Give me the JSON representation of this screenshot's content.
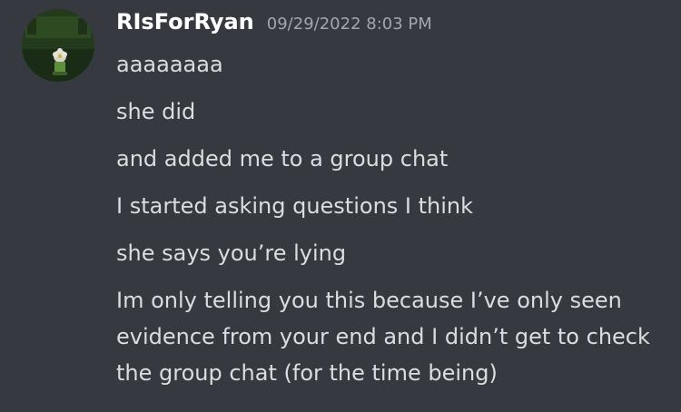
{
  "message": {
    "author": "RIsForRyan",
    "timestamp": "09/29/2022 8:03 PM",
    "lines": [
      "aaaaaaaa",
      "she did",
      "and added me to a group chat",
      "I started asking questions I think",
      "she says you’re lying",
      "Im only telling you this because I’ve only seen evidence from your end and I didn’t get to check the group chat (for the time being)"
    ]
  },
  "colors": {
    "background": "#36393f",
    "author": "#ffffff",
    "text": "#dcddde",
    "timestamp": "#a3a6aa"
  },
  "icons": {
    "avatar": "avatar-image"
  }
}
